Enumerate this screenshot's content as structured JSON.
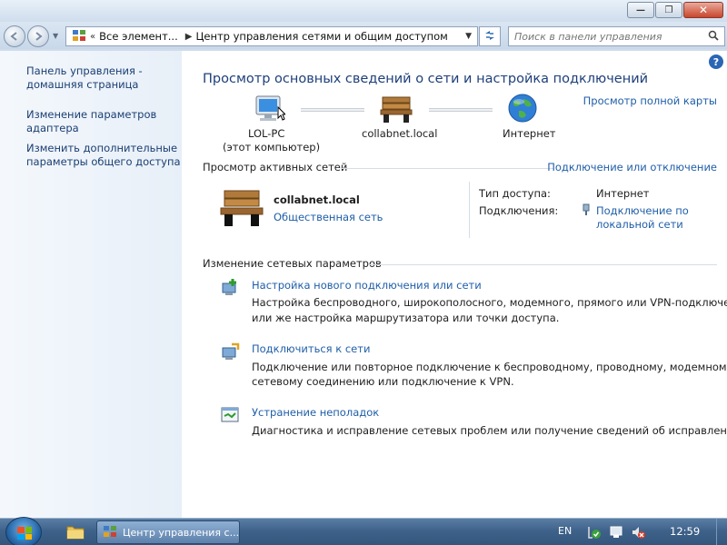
{
  "window": {
    "minimize_glyph": "—",
    "maximize_glyph": "❐",
    "close_glyph": "✕"
  },
  "nav": {
    "back_icon": "back-arrow-icon",
    "forward_icon": "forward-arrow-icon",
    "breadcrumb": [
      "Все элемент...",
      "Центр управления сетями и общим доступом"
    ],
    "search_placeholder": "Поиск в панели управления"
  },
  "sidebar": {
    "items": [
      {
        "label_line1": "Панель управления -",
        "label_line2": "домашняя страница"
      },
      {
        "label_line1": "Изменение параметров",
        "label_line2": "адаптера"
      },
      {
        "label_line1": "Изменить дополнительные",
        "label_line2": "параметры общего доступа"
      }
    ]
  },
  "main": {
    "title": "Просмотр основных сведений о сети и настройка подключений",
    "full_map_link": "Просмотр полной карты",
    "map": {
      "computer_name": "LOL-PC",
      "computer_sub": "(этот компьютер)",
      "network_name": "collabnet.local",
      "internet": "Интернет"
    },
    "active_networks": {
      "heading": "Просмотр активных сетей",
      "connect_link": "Подключение или отключение",
      "network_name": "collabnet.local",
      "network_type": "Общественная сеть",
      "access_type_label": "Тип доступа:",
      "access_type_value": "Интернет",
      "connections_label": "Подключения:",
      "connection_line1": "Подключение по",
      "connection_line2": "локальной сети"
    },
    "change_settings": {
      "heading": "Изменение сетевых параметров",
      "tasks": [
        {
          "title": "Настройка нового подключения или сети",
          "desc_line1": "Настройка беспроводного, широкополосного, модемного, прямого или VPN-подключения",
          "desc_line2": "или же настройка маршрутизатора или точки доступа."
        },
        {
          "title": "Подключиться к сети",
          "desc_line1": "Подключение или повторное подключение к беспроводному, проводному, модемному",
          "desc_line2": "сетевому соединению или подключение к VPN."
        },
        {
          "title": "Устранение неполадок",
          "desc_line1": "Диагностика и исправление сетевых проблем или получение сведений об исправлении.",
          "desc_line2": ""
        }
      ]
    }
  },
  "taskbar": {
    "task_label": "Центр управления с...",
    "language": "EN",
    "clock": "12:59"
  },
  "colors": {
    "link": "#1f5ea8",
    "title": "#1e3f7a",
    "taskbar": "#3f628a"
  }
}
